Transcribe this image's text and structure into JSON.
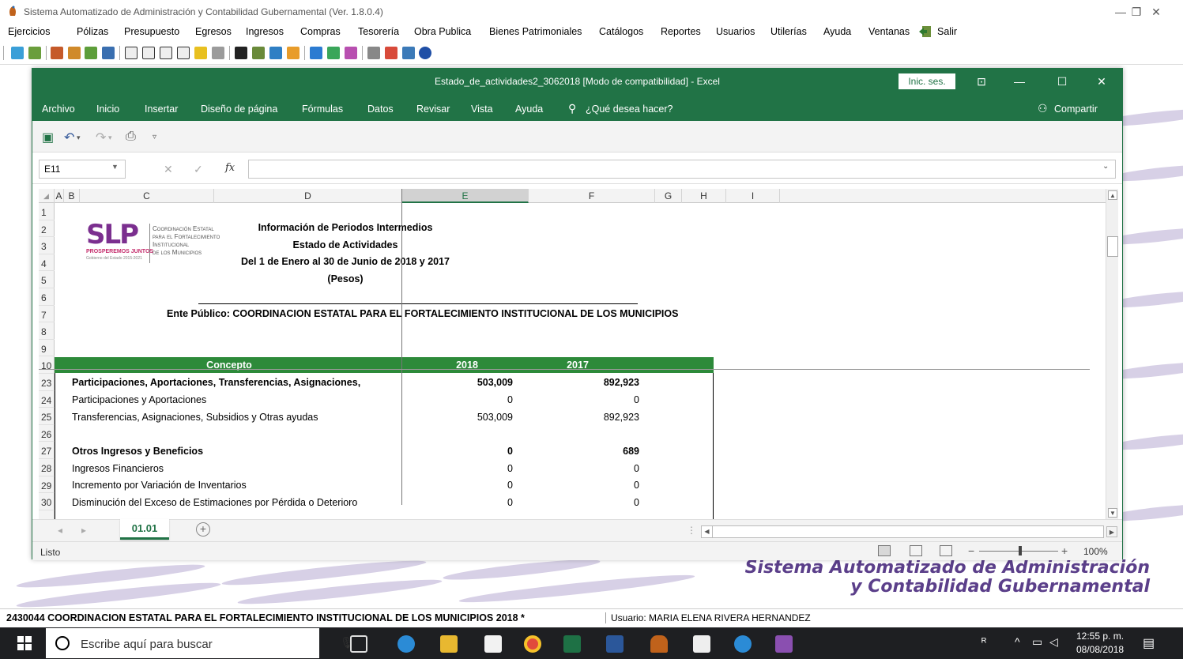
{
  "app": {
    "title": "Sistema Automatizado de Administración y Contabilidad Gubernamental  (Ver. 1.8.0.4)",
    "menu": [
      "Ejercicios",
      "Pólizas",
      "Presupuesto",
      "Egresos",
      "Ingresos",
      "Compras",
      "Tesorería",
      "Obra Publica",
      "Bienes Patrimoniales",
      "Catálogos",
      "Reportes",
      "Usuarios",
      "Utilerías",
      "Ayuda",
      "Ventanas",
      "Salir"
    ],
    "brand_line1": "Sistema Automatizado de Administración",
    "brand_line2": "y Contabilidad Gubernamental",
    "status_entity": "2430044 COORDINACION ESTATAL PARA EL FORTALECIMIENTO INSTITUCIONAL DE LOS MUNICIPIOS  2018  *",
    "status_user": "Usuario: MARIA ELENA RIVERA HERNANDEZ"
  },
  "excel": {
    "title": "Estado_de_actividades2_3062018  [Modo de compatibilidad]  -  Excel",
    "signin": "Inic. ses.",
    "ribbon_tabs": [
      "Archivo",
      "Inicio",
      "Insertar",
      "Diseño de página",
      "Fórmulas",
      "Datos",
      "Revisar",
      "Vista",
      "Ayuda"
    ],
    "tell_me": "¿Qué desea hacer?",
    "share": "Compartir",
    "namebox": "E11",
    "fx": "fx",
    "columns": [
      "A",
      "B",
      "C",
      "D",
      "E",
      "F",
      "G",
      "H",
      "I"
    ],
    "rows": [
      "1",
      "2",
      "3",
      "4",
      "5",
      "6",
      "7",
      "8",
      "9",
      "10",
      "23",
      "24",
      "25",
      "26",
      "27",
      "28",
      "29",
      "30"
    ],
    "sheet_tab": "01.01",
    "status": "Listo",
    "zoom": "100%"
  },
  "report": {
    "logo_mark": "SLP",
    "logo_tag1": "PROSPEREMOS JUNTOS",
    "logo_tag2": "Gobierno del Estado 2015-2021",
    "logo_org": [
      "Coordinación Estatal",
      "para el Fortalecimiento",
      "Institucional",
      "de los Municipios"
    ],
    "heading1": "Información de Periodos Intermedios",
    "heading2": "Estado de Actividades",
    "heading3": "Del 1 de Enero al 30 de Junio de 2018 y 2017",
    "heading4": "(Pesos)",
    "ente": "Ente Público: COORDINACION ESTATAL PARA EL FORTALECIMIENTO INSTITUCIONAL DE LOS MUNICIPIOS",
    "col_concepto": "Concepto",
    "col_2018": "2018",
    "col_2017": "2017",
    "lines": [
      {
        "concept": "Participaciones, Aportaciones, Transferencias, Asignaciones,",
        "v2018": "503,009",
        "v2017": "892,923",
        "bold": true
      },
      {
        "concept": "Participaciones y Aportaciones",
        "v2018": "0",
        "v2017": "0",
        "bold": false
      },
      {
        "concept": "Transferencias, Asignaciones, Subsidios y Otras ayudas",
        "v2018": "503,009",
        "v2017": "892,923",
        "bold": false
      },
      {
        "concept": "",
        "v2018": "",
        "v2017": "",
        "bold": false
      },
      {
        "concept": "Otros Ingresos y Beneficios",
        "v2018": "0",
        "v2017": "689",
        "bold": true
      },
      {
        "concept": "Ingresos Financieros",
        "v2018": "0",
        "v2017": "0",
        "bold": false
      },
      {
        "concept": "Incremento por Variación de Inventarios",
        "v2018": "0",
        "v2017": "0",
        "bold": false
      },
      {
        "concept": "Disminución del Exceso de Estimaciones por Pérdida o Deterioro",
        "v2018": "0",
        "v2017": "0",
        "bold": false
      }
    ]
  },
  "taskbar": {
    "search_placeholder": "Escribe aquí para buscar",
    "time": "12:55 p. m.",
    "date": "08/08/2018"
  },
  "colors": {
    "excel_green": "#217346",
    "table_header_green": "#2d8a3a",
    "brand_purple": "#5b3f8a"
  }
}
